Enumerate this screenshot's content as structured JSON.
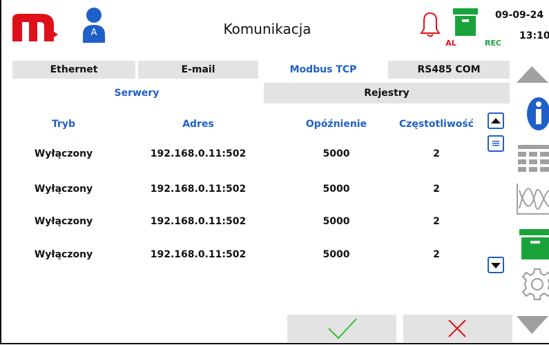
{
  "header": {
    "title": "Komunikacja",
    "user_badge": "A",
    "alarm_label": "AL",
    "rec_label": "REC",
    "date": "09-09-24",
    "time": "13:10"
  },
  "tabs": [
    {
      "label": "Ethernet",
      "active": false
    },
    {
      "label": "E-mail",
      "active": false
    },
    {
      "label": "Modbus TCP",
      "active": true
    },
    {
      "label": "RS485 COM",
      "active": false
    }
  ],
  "subtabs": [
    {
      "label": "Serwery",
      "active": true
    },
    {
      "label": "Rejestry",
      "active": false
    }
  ],
  "table": {
    "columns": [
      "Tryb",
      "Adres",
      "Opóźnienie",
      "Częstotliwość"
    ],
    "rows": [
      [
        "Wyłączony",
        "192.168.0.11:502",
        "5000",
        "2"
      ],
      [
        "Wyłączony",
        "192.168.0.11:502",
        "5000",
        "2"
      ],
      [
        "Wyłączony",
        "192.168.0.11:502",
        "5000",
        "2"
      ],
      [
        "Wyłączony",
        "192.168.0.11:502",
        "5000",
        "2"
      ]
    ]
  },
  "colors": {
    "accent_blue": "#1f5fc8",
    "logo_red": "#e0101a",
    "rec_green": "#1aa33a",
    "button_gray": "#e3e3e3",
    "icon_gray": "#a0a0a0"
  },
  "icons": [
    "logo-icon",
    "user-icon",
    "bell-icon",
    "archive-icon",
    "scroll-up-icon",
    "scroll-down-icon",
    "list-icon",
    "arrow-up-icon",
    "info-icon",
    "table-icon",
    "chart-icon",
    "archive-icon",
    "gear-icon",
    "arrow-down-icon",
    "check-icon",
    "close-icon"
  ]
}
